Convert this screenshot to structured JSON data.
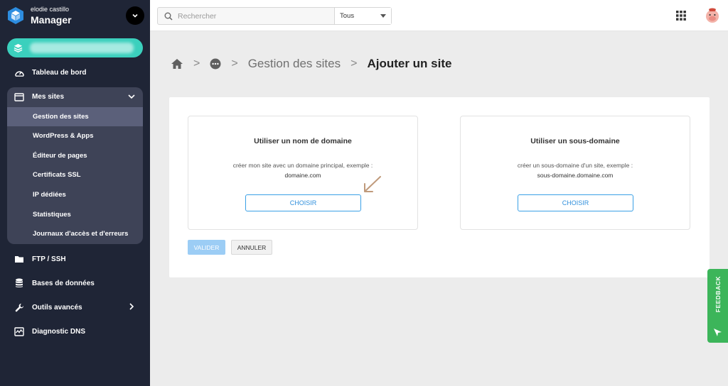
{
  "brand": {
    "user": "elodie castillo",
    "name": "Manager"
  },
  "sidebar": {
    "dashboard": "Tableau de bord",
    "my_sites": {
      "label": "Mes sites",
      "items": [
        {
          "label": "Gestion des sites",
          "active": true
        },
        {
          "label": "WordPress & Apps"
        },
        {
          "label": "Éditeur de pages"
        },
        {
          "label": "Certificats SSL"
        },
        {
          "label": "IP dédiées"
        },
        {
          "label": "Statistiques"
        },
        {
          "label": "Journaux d'accès et d'erreurs"
        }
      ]
    },
    "ftp": "FTP / SSH",
    "databases": "Bases de données",
    "advanced_tools": "Outils avancés",
    "dns": "Diagnostic DNS"
  },
  "topbar": {
    "search_placeholder": "Rechercher",
    "search_scope": "Tous"
  },
  "breadcrumb": {
    "parent": "Gestion des sites",
    "current": "Ajouter un site"
  },
  "options": [
    {
      "title": "Utiliser un nom de domaine",
      "description": "créer mon site avec un domaine principal, exemple :",
      "example": "domaine.com",
      "button": "CHOISIR"
    },
    {
      "title": "Utiliser un sous-domaine",
      "description": "créer un sous-domaine d'un site, exemple :",
      "example": "sous-domaine.domaine.com",
      "button": "CHOISIR"
    }
  ],
  "actions": {
    "validate": "VALIDER",
    "cancel": "ANNULER"
  },
  "feedback": {
    "label": "FEEDBACK"
  },
  "colors": {
    "sidebar_bg": "#1f2536",
    "accent_teal": "#3bd0bd",
    "primary_blue": "#2f8fdc",
    "feedback_green": "#3cb55a"
  }
}
